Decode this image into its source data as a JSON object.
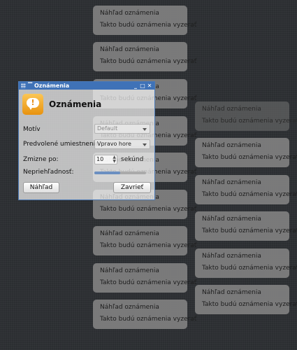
{
  "notification": {
    "heading": "Náhľad oznámenia",
    "body": "Takto budú oznámenia vyzerať"
  },
  "dialog": {
    "window_title": "Oznámenia",
    "header_title": "Oznámenia",
    "theme": {
      "label": "Motív",
      "value": "Default"
    },
    "placement": {
      "label": "Predvolené umiestnenie:",
      "value": "Vpravo hore"
    },
    "timeout": {
      "label": "Zmizne po:",
      "value": "10",
      "unit": "sekúnd"
    },
    "opacity": {
      "label": "Nepriehľadnosť:",
      "level_percent": 50
    },
    "preview_button": "Náhľad",
    "close_button": "Zavrieť"
  },
  "colors": {
    "titlebar": "#3f72b7",
    "notification_bg": "#808080",
    "desktop_bg": "#2b2e31",
    "icon": "#f0a520"
  },
  "icons": {
    "app": "notification-bubble-icon",
    "titlebar_menu": "window-menu-icon",
    "minimize": "minimize-icon",
    "maximize": "maximize-icon",
    "close": "close-icon"
  }
}
